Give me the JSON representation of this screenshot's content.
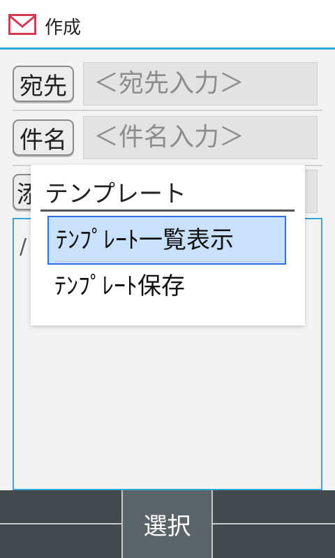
{
  "header": {
    "title": "作成",
    "icon": "mail-icon"
  },
  "fields": {
    "to": {
      "label": "宛先",
      "placeholder": "＜宛先入力＞"
    },
    "subject": {
      "label": "件名",
      "placeholder": "＜件名入力＞"
    },
    "attach": {
      "label": "添"
    }
  },
  "popup": {
    "title": "テンプレート",
    "items": [
      {
        "label": "ﾃﾝﾌﾟﾚｰﾄ一覧表示",
        "selected": true
      },
      {
        "label": "ﾃﾝﾌﾟﾚｰﾄ保存",
        "selected": false
      }
    ]
  },
  "bottom_bar": {
    "center_label": "選択"
  },
  "colors": {
    "accent": "#2ea7d9",
    "selection_bg": "#c9e1fb",
    "selection_border": "#2c6ee8",
    "bottom_bar": "#424a4d"
  }
}
